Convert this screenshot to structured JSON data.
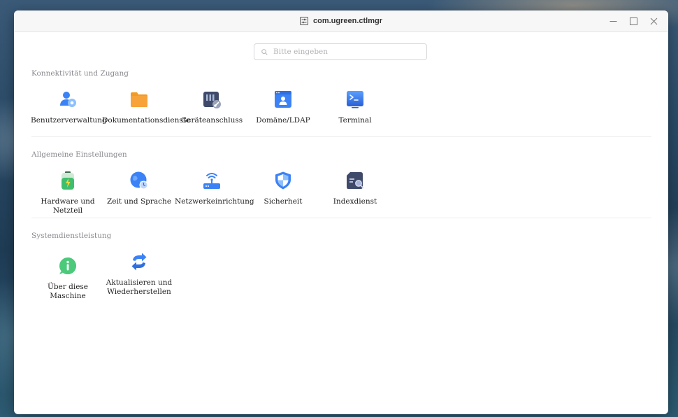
{
  "window": {
    "title": "com.ugreen.ctlmgr",
    "app_icon": "sliders-icon"
  },
  "search": {
    "placeholder": "Bitte eingeben"
  },
  "sections": [
    {
      "title": "Konnektivität und Zugang",
      "items": [
        {
          "label": "Benutzerverwaltung",
          "icon": "users-icon"
        },
        {
          "label": "Dokumentationsdienste",
          "icon": "folder-icon"
        },
        {
          "label": "Geräteanschluss",
          "icon": "device-connection-icon"
        },
        {
          "label": "Domäne/LDAP",
          "icon": "domain-ldap-icon"
        },
        {
          "label": "Terminal",
          "icon": "terminal-icon"
        }
      ]
    },
    {
      "title": "Allgemeine Einstellungen",
      "items": [
        {
          "label": "Hardware und Netzteil",
          "icon": "battery-icon"
        },
        {
          "label": "Zeit und Sprache",
          "icon": "globe-clock-icon"
        },
        {
          "label": "Netzwerkeinrichtung",
          "icon": "router-icon"
        },
        {
          "label": "Sicherheit",
          "icon": "shield-icon"
        },
        {
          "label": "Indexdienst",
          "icon": "index-search-icon"
        }
      ]
    },
    {
      "title": "Systemdienstleistung",
      "items": [
        {
          "label": "Über diese Maschine",
          "icon": "info-icon"
        },
        {
          "label_line1": "Aktualisieren und",
          "label_line2": "Wiederherstellen",
          "icon": "refresh-icon"
        }
      ]
    }
  ],
  "colors": {
    "accent_blue": "#3b82f6",
    "folder_orange": "#f7a33a",
    "info_green": "#4cc97a"
  }
}
